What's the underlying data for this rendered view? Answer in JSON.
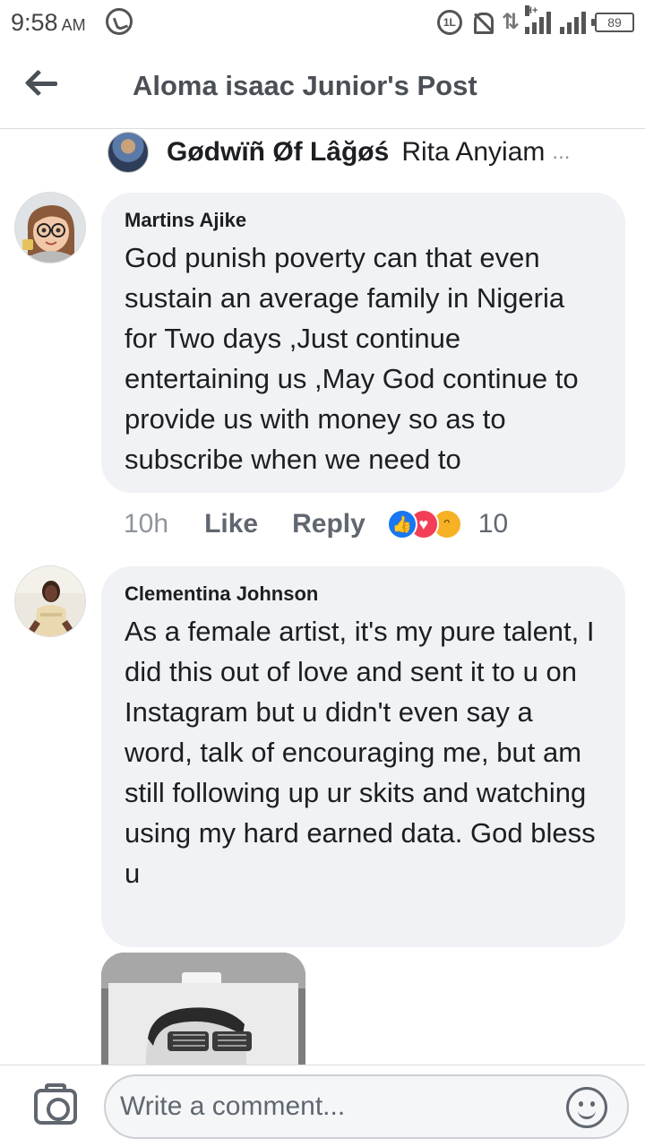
{
  "status_bar": {
    "time": "9:58",
    "ampm": "AM",
    "battery": "89",
    "network": "H+",
    "sim_badge": "1L"
  },
  "header": {
    "title": "Aloma isaac Junior's Post"
  },
  "previous_reply": {
    "author": "Gødwïñ Øf Lâğøś",
    "text": "Rita Anyiam",
    "ellipsis": "..."
  },
  "comments": [
    {
      "author": "Martins Ajike",
      "text": "God punish poverty can that even sustain an average family in Nigeria for Two days ,Just continue entertaining us ,May God continue to provide us with money so as to subscribe when we need to",
      "time": "10h",
      "like_label": "Like",
      "reply_label": "Reply",
      "reaction_count": "10",
      "reactions": [
        "like-icon",
        "love-icon",
        "haha-icon"
      ]
    },
    {
      "author": "Clementina Johnson",
      "text": "As a female artist, it's my pure talent, I did this out of love and sent it to u on Instagram but u didn't even say a word, talk of encouraging me, but am still following up ur skits and watching using my hard earned data. God bless u",
      "has_image": true
    }
  ],
  "composer": {
    "placeholder": "Write a comment..."
  },
  "colors": {
    "bubble": "#f0f2f5",
    "like_blue": "#1877f2",
    "love_red": "#f33e58",
    "haha_yellow": "#f7b125",
    "header_text": "#4b4f56"
  }
}
